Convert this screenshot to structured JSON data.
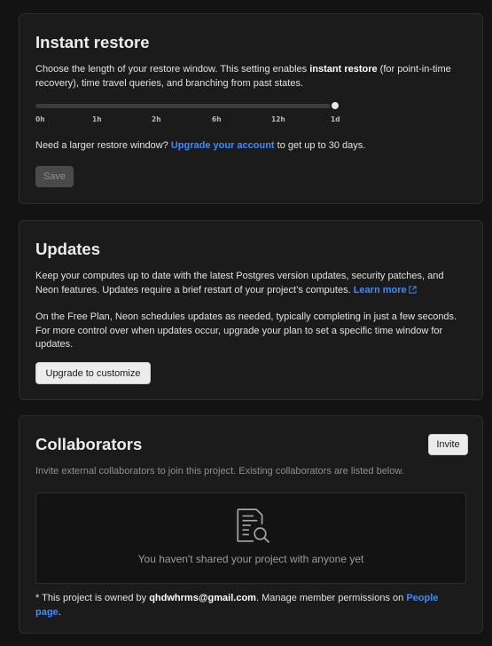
{
  "restore": {
    "title": "Instant restore",
    "desc_1": "Choose the length of your restore window. This setting enables ",
    "desc_bold": "instant restore",
    "desc_2": " (for point-in-time recovery), time travel queries, and branching from past states.",
    "slider": {
      "ticks": [
        "0h",
        "1h",
        "2h",
        "6h",
        "12h",
        "1d"
      ],
      "selected": "1d"
    },
    "upgrade_1": "Need a larger restore window? ",
    "upgrade_link": "Upgrade your account",
    "upgrade_2": " to get up to 30 days.",
    "save_label": "Save"
  },
  "updates": {
    "title": "Updates",
    "desc_1": "Keep your computes up to date with the latest Postgres version updates, security patches, and Neon features. Updates require a brief restart of your project’s computes. ",
    "learn_more": "Learn more",
    "desc_2": "On the Free Plan, Neon schedules updates as needed, typically completing in just a few seconds. For more control over when updates occur, upgrade your plan to set a specific time window for updates.",
    "button_label": "Upgrade to customize"
  },
  "collaborators": {
    "title": "Collaborators",
    "invite_label": "Invite",
    "desc": "Invite external collaborators to join this project. Existing collaborators are listed below.",
    "empty_icon": "document-search-icon",
    "empty_text": "You haven't shared your project with anyone yet",
    "owner_1": "* This project is owned by ",
    "owner_email": "qhdwhrms@gmail.com",
    "owner_2": ". Manage member permissions on ",
    "people_link": "People page",
    "owner_3": "."
  },
  "colors": {
    "accent": "#3d8bff",
    "card_bg": "#1b1b1b",
    "page_bg": "#131313"
  }
}
